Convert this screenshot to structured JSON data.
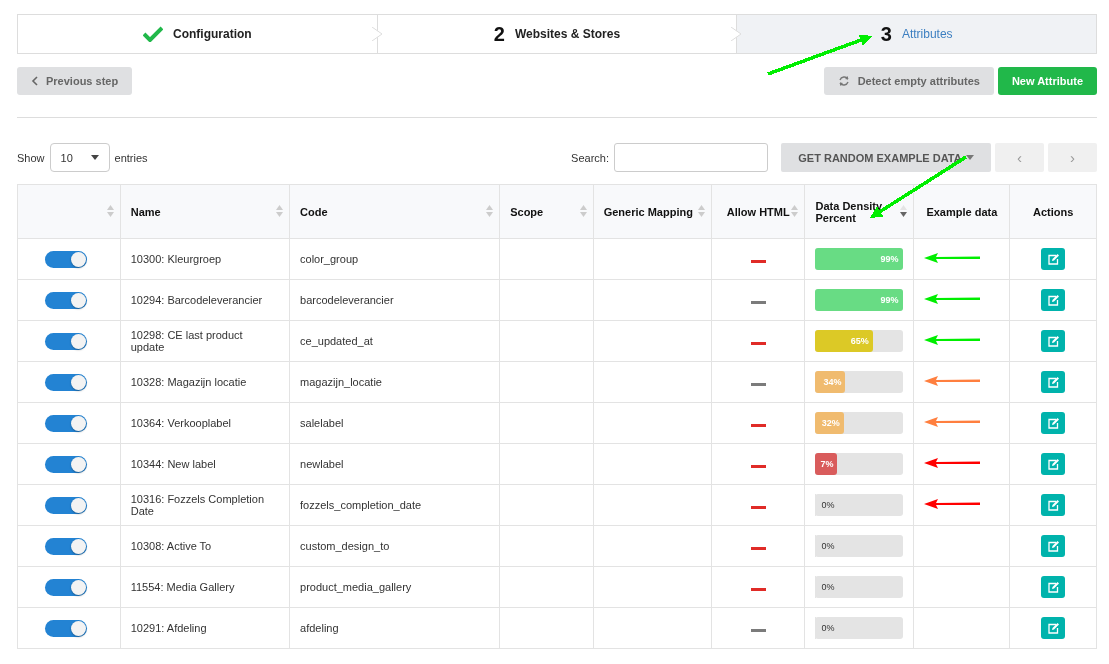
{
  "steps": [
    {
      "label": "Configuration",
      "done": true,
      "selected": false
    },
    {
      "number": "2",
      "label": "Websites & Stores",
      "done": false,
      "selected": false
    },
    {
      "number": "3",
      "label": "Attributes",
      "done": false,
      "selected": true
    }
  ],
  "previous_button": "Previous step",
  "detect_button": "Detect empty attributes",
  "new_button": "New Attribute",
  "length": {
    "before": "Show",
    "value": "10",
    "after": "entries"
  },
  "search": {
    "label": "Search:"
  },
  "random_button": "GET RANDOM EXAMPLE DATA",
  "pager": {
    "prev": "‹",
    "next": "›"
  },
  "table": {
    "columns": [
      {
        "sortable": true,
        "sorted": false
      },
      {
        "label": "Name",
        "sortable": true,
        "sorted": false
      },
      {
        "label": "Code",
        "sortable": true,
        "sorted": false
      },
      {
        "label": "Scope",
        "sortable": true,
        "sorted": false
      },
      {
        "label": "Generic Mapping",
        "sortable": true,
        "sorted": false
      },
      {
        "label": "Allow HTML",
        "sortable": true,
        "sorted": false
      },
      {
        "label": "Data Density Percent",
        "sortable": true,
        "sorted": true
      },
      {
        "label": "Example data"
      },
      {
        "label": "Actions"
      }
    ],
    "rows": [
      {
        "on": true,
        "name": "10300: Kleurgroep",
        "code": "color_group",
        "allow_html": {
          "color": "#e02b27"
        },
        "density": {
          "level": 0.99,
          "reading": "99%",
          "color": "#68dc84"
        },
        "arrow": {
          "color": "#00ee00"
        }
      },
      {
        "on": true,
        "name": "10294: Barcodeleverancier",
        "code": "barcodeleverancier",
        "allow_html": {
          "color": "#7b7b7b"
        },
        "density": {
          "level": 0.99,
          "reading": "99%",
          "color": "#68dc84"
        },
        "arrow": {
          "color": "#00ee00"
        }
      },
      {
        "on": true,
        "name": "10298: CE last product update",
        "code": "ce_updated_at",
        "allow_html": {
          "color": "#e02b27"
        },
        "density": {
          "level": 0.65,
          "reading": "65%",
          "color": "#dcc926"
        },
        "arrow": {
          "color": "#00ee00"
        }
      },
      {
        "on": true,
        "name": "10328: Magazijn locatie",
        "code": "magazijn_locatie",
        "allow_html": {
          "color": "#7b7b7b"
        },
        "density": {
          "level": 0.34,
          "reading": "34%",
          "color": "#f0bb6f"
        },
        "arrow": {
          "color": "#ff7f3f"
        }
      },
      {
        "on": true,
        "name": "10364: Verkooplabel",
        "code": "salelabel",
        "allow_html": {
          "color": "#e02b27"
        },
        "density": {
          "level": 0.32,
          "reading": "32%",
          "color": "#f0bb6f"
        },
        "arrow": {
          "color": "#ff7f3f"
        }
      },
      {
        "on": true,
        "name": "10344: New label",
        "code": "newlabel",
        "allow_html": {
          "color": "#e02b27"
        },
        "density": {
          "level": 0.07,
          "reading": "7%",
          "color": "#d95c5c"
        },
        "arrow": {
          "color": "#ff0000"
        }
      },
      {
        "on": true,
        "name": "10316: Fozzels Completion Date",
        "code": "fozzels_completion_date",
        "allow_html": {
          "color": "#e02b27"
        },
        "density": {
          "level": 0,
          "reading": "0%"
        },
        "arrow": {
          "color": "#ff0000"
        }
      },
      {
        "on": true,
        "name": "10308: Active To",
        "code": "custom_design_to",
        "allow_html": {
          "color": "#e02b27"
        },
        "density": {
          "level": 0,
          "reading": "0%"
        }
      },
      {
        "on": true,
        "name": "11554: Media Gallery",
        "code": "product_media_gallery",
        "allow_html": {
          "color": "#e02b27"
        },
        "density": {
          "level": 0,
          "reading": "0%"
        }
      },
      {
        "on": true,
        "name": "10291: Afdeling",
        "code": "afdeling",
        "allow_html": {
          "color": "#7b7b7b"
        },
        "density": {
          "level": 0,
          "reading": "0%"
        }
      }
    ]
  },
  "annotations": [
    {
      "color": "#00ee00"
    },
    {
      "color": "#00ee00"
    }
  ]
}
